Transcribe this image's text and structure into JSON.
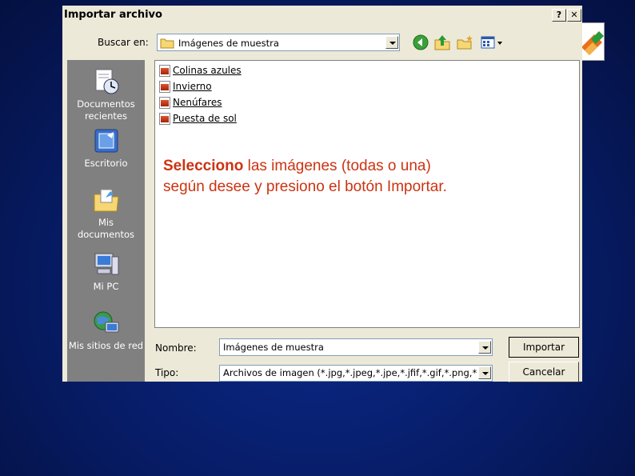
{
  "dialog": {
    "title": "Importar archivo",
    "help_label": "?",
    "close_label": "✕"
  },
  "lookin": {
    "label": "Buscar en:",
    "value": "Imágenes de muestra"
  },
  "places": [
    {
      "line1": "Documentos",
      "line2": "recientes",
      "icon": "recent-documents-icon"
    },
    {
      "line1": "Escritorio",
      "line2": "",
      "icon": "desktop-icon"
    },
    {
      "line1": "Mis",
      "line2": "documentos",
      "icon": "my-documents-icon"
    },
    {
      "line1": "Mi PC",
      "line2": "",
      "icon": "my-computer-icon"
    },
    {
      "line1": "Mis sitios de red",
      "line2": "",
      "icon": "network-places-icon"
    }
  ],
  "files": [
    "Colinas azules",
    "Invierno",
    "Nenúfares",
    "Puesta de sol"
  ],
  "caption": {
    "bold": "Selecciono",
    "rest1": " las imágenes (todas o una)",
    "line2": "según desee y presiono el botón Importar."
  },
  "name_field": {
    "label": "Nombre:",
    "value": "Imágenes de muestra"
  },
  "type_field": {
    "label": "Tipo:",
    "value": "Archivos de imagen (*.jpg,*.jpeg,*.jpe,*.jfif,*.gif,*.png,*.bm"
  },
  "buttons": {
    "import": "Importar",
    "cancel": "Cancelar"
  },
  "colors": {
    "background": "#071c66",
    "caption": "#cc3311",
    "places_bar": "#808080"
  }
}
